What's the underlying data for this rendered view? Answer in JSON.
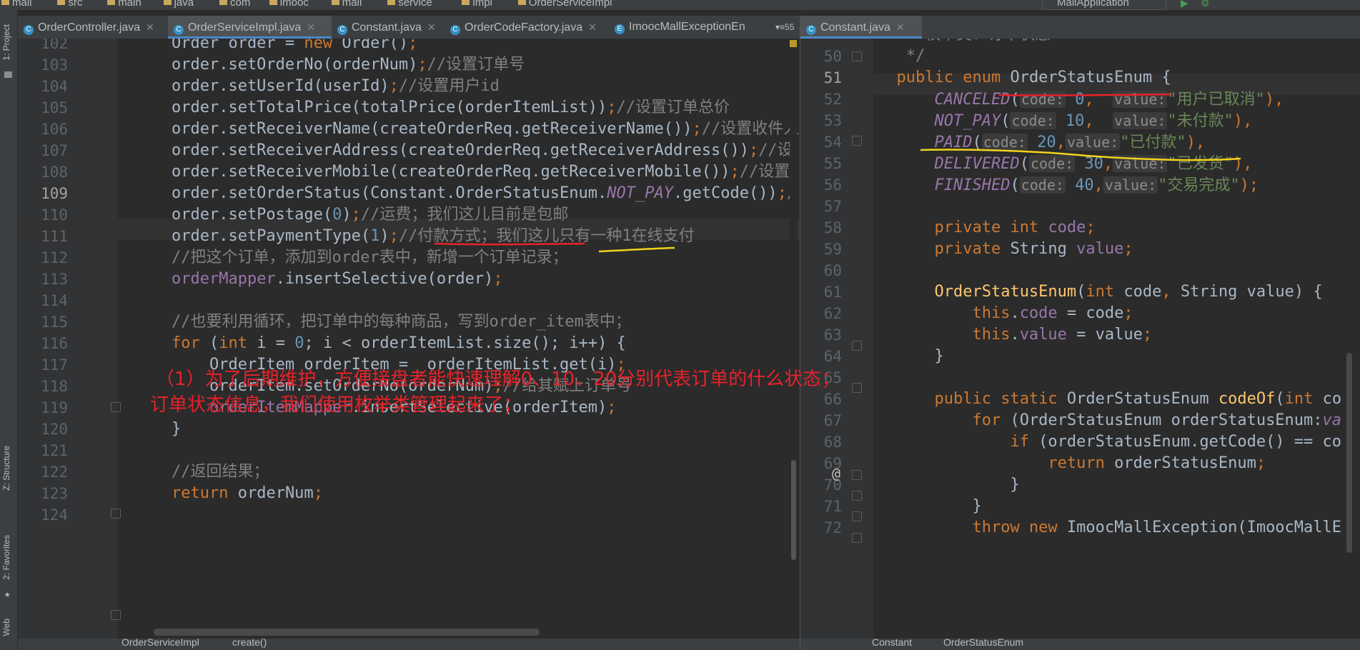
{
  "navbar": {
    "crumbs": [
      "mall",
      "src",
      "main",
      "java",
      "com",
      "imooc",
      "mall",
      "service",
      "impl",
      "OrderServiceImpl"
    ],
    "run_config": "MallApplication"
  },
  "left_strip": {
    "project_label": "1: Project",
    "structure_label": "Z: Structure",
    "favorites_label": "2: Favorites",
    "web_label": "Web"
  },
  "left_tabs": [
    {
      "label": "OrderController.java",
      "active": false
    },
    {
      "label": "OrderServiceImpl.java",
      "active": true
    },
    {
      "label": "Constant.java",
      "active": false
    },
    {
      "label": "OrderCodeFactory.java",
      "active": false
    },
    {
      "label": "ImoocMallExceptionEn",
      "active": false
    }
  ],
  "left_tabs_overflow": "▾≡55",
  "right_tabs": [
    {
      "label": "Constant.java",
      "active": true
    }
  ],
  "left_editor": {
    "lines": [
      {
        "n": "102",
        "segs": [
          [
            "    Order order = ",
            ""
          ],
          [
            "new",
            "kw"
          ],
          [
            " Order()",
            ""
          ],
          [
            ";",
            "kw"
          ]
        ]
      },
      {
        "n": "103",
        "segs": [
          [
            "    order.setOrderNo(orderNum)",
            ""
          ],
          [
            ";",
            "kw"
          ],
          [
            "//设置订单号",
            "cmt"
          ]
        ]
      },
      {
        "n": "104",
        "segs": [
          [
            "    order.setUserId(userId)",
            ""
          ],
          [
            ";",
            "kw"
          ],
          [
            "//设置用户id",
            "cmt"
          ]
        ]
      },
      {
        "n": "105",
        "segs": [
          [
            "    order.setTotalPrice(totalPrice(orderItemList))",
            ""
          ],
          [
            ";",
            "kw"
          ],
          [
            "//设置订单总价",
            "cmt"
          ]
        ]
      },
      {
        "n": "106",
        "segs": [
          [
            "    order.setReceiverName(createOrderReq.getReceiverName())",
            ""
          ],
          [
            ";",
            "kw"
          ],
          [
            "//设置收件人",
            "cmt"
          ]
        ]
      },
      {
        "n": "107",
        "segs": [
          [
            "    order.setReceiverAddress(createOrderReq.getReceiverAddress())",
            ""
          ],
          [
            ";",
            "kw"
          ],
          [
            "//设",
            "cmt"
          ]
        ]
      },
      {
        "n": "108",
        "segs": [
          [
            "    order.setReceiverMobile(createOrderReq.getReceiverMobile())",
            ""
          ],
          [
            ";",
            "kw"
          ],
          [
            "//设置",
            "cmt"
          ]
        ]
      },
      {
        "n": "109",
        "cur": true,
        "segs": [
          [
            "    order.setOrderStatus(Constant.OrderStatusEnum.",
            ""
          ],
          [
            "NOT_PAY",
            "fld ital"
          ],
          [
            ".getCode())",
            ""
          ],
          [
            ";",
            "kw"
          ],
          [
            "/",
            "cmt"
          ]
        ]
      },
      {
        "n": "110",
        "segs": [
          [
            "    order.setPostage(",
            ""
          ],
          [
            "0",
            "num"
          ],
          [
            ")",
            ""
          ],
          [
            ";",
            "kw"
          ],
          [
            "//运费；我们这儿目前是包邮",
            "cmt"
          ]
        ]
      },
      {
        "n": "111",
        "segs": [
          [
            "    order.setPaymentType(",
            ""
          ],
          [
            "1",
            "num"
          ],
          [
            ")",
            ""
          ],
          [
            ";",
            "kw"
          ],
          [
            "//付款方式；我们这儿只有一种1在线支付",
            "cmt"
          ]
        ]
      },
      {
        "n": "112",
        "segs": [
          [
            "    ",
            ""
          ],
          [
            "//把这个订单，添加到order表中，新增一个订单记录；",
            "cmt"
          ]
        ]
      },
      {
        "n": "113",
        "segs": [
          [
            "    ",
            ""
          ],
          [
            "orderMapper",
            "fld"
          ],
          [
            ".insertSelective(order)",
            ""
          ],
          [
            ";",
            "kw"
          ]
        ]
      },
      {
        "n": "114",
        "segs": [
          [
            "",
            ""
          ]
        ]
      },
      {
        "n": "115",
        "segs": [
          [
            "    ",
            ""
          ],
          [
            "//也要利用循环，把订单中的每种商品，写到order_item表中；",
            "cmt"
          ]
        ]
      },
      {
        "n": "116",
        "segs": [
          [
            "    ",
            ""
          ],
          [
            "for",
            "kw"
          ],
          [
            " (",
            ""
          ],
          [
            "int",
            "kw"
          ],
          [
            " i = ",
            ""
          ],
          [
            "0",
            "num"
          ],
          [
            "; i < orderItemList.size(); i++) {",
            ""
          ]
        ]
      },
      {
        "n": "117",
        "segs": [
          [
            "        OrderItem orderItem =  orderItemList.get(i)",
            ""
          ],
          [
            ";",
            "kw"
          ]
        ]
      },
      {
        "n": "118",
        "segs": [
          [
            "        orderItem.setOrderNo(orderNum)",
            ""
          ],
          [
            ";",
            "kw"
          ],
          [
            "//给其赋上订单号",
            "cmt"
          ]
        ]
      },
      {
        "n": "119",
        "segs": [
          [
            "        ",
            ""
          ],
          [
            "orderItemMapper",
            "fld"
          ],
          [
            ".insertSelective(orderItem)",
            ""
          ],
          [
            ";",
            "kw"
          ]
        ]
      },
      {
        "n": "120",
        "segs": [
          [
            "    }",
            ""
          ]
        ]
      },
      {
        "n": "121",
        "segs": [
          [
            "",
            ""
          ]
        ]
      },
      {
        "n": "122",
        "segs": [
          [
            "    ",
            ""
          ],
          [
            "//返回结果；",
            "cmt"
          ]
        ]
      },
      {
        "n": "123",
        "segs": [
          [
            "    ",
            ""
          ],
          [
            "return",
            "kw"
          ],
          [
            " orderNum",
            ""
          ],
          [
            ";",
            "kw"
          ]
        ]
      },
      {
        "n": "124",
        "segs": [
          [
            "",
            ""
          ]
        ]
      }
    ],
    "breadcrumb": [
      "OrderServiceImpl",
      "create()"
    ]
  },
  "right_editor": {
    "lines": [
      {
        "n": "",
        "segs": [
          [
            "   ",
            ""
          ],
          [
            "* 枚举类：订单状态",
            "cmt"
          ]
        ]
      },
      {
        "n": "50",
        "segs": [
          [
            "   ",
            ""
          ],
          [
            "*/",
            "cmt"
          ]
        ]
      },
      {
        "n": "51",
        "cur": true,
        "segs": [
          [
            "  ",
            ""
          ],
          [
            "public enum",
            "kw"
          ],
          [
            " OrderStatusEnum {",
            ""
          ]
        ]
      },
      {
        "n": "52",
        "segs": [
          [
            "      ",
            ""
          ],
          [
            "CANCELED",
            "fld ital"
          ],
          [
            "(",
            ""
          ],
          [
            "code:",
            "hint"
          ],
          [
            " ",
            ""
          ],
          [
            "0",
            "num"
          ],
          [
            ",  ",
            "kw"
          ],
          [
            "value:",
            "hint"
          ],
          [
            "\"用户已取消\"",
            "str"
          ],
          [
            "),",
            "kw"
          ]
        ]
      },
      {
        "n": "53",
        "segs": [
          [
            "      ",
            ""
          ],
          [
            "NOT_PAY",
            "fld ital"
          ],
          [
            "(",
            ""
          ],
          [
            "code:",
            "hint"
          ],
          [
            " ",
            ""
          ],
          [
            "10",
            "num"
          ],
          [
            ",  ",
            "kw"
          ],
          [
            "value:",
            "hint"
          ],
          [
            "\"未付款\"",
            "str"
          ],
          [
            "),",
            "kw"
          ]
        ]
      },
      {
        "n": "54",
        "segs": [
          [
            "      ",
            ""
          ],
          [
            "PAID",
            "fld ital"
          ],
          [
            "(",
            ""
          ],
          [
            "code:",
            "hint"
          ],
          [
            " ",
            ""
          ],
          [
            "20",
            "num"
          ],
          [
            ",",
            "kw"
          ],
          [
            "value:",
            "hint"
          ],
          [
            "\"已付款\"",
            "str"
          ],
          [
            "),",
            "kw"
          ]
        ]
      },
      {
        "n": "55",
        "segs": [
          [
            "      ",
            ""
          ],
          [
            "DELIVERED",
            "fld ital"
          ],
          [
            "(",
            ""
          ],
          [
            "code:",
            "hint"
          ],
          [
            " ",
            ""
          ],
          [
            "30",
            "num"
          ],
          [
            ",",
            "kw"
          ],
          [
            "value:",
            "hint"
          ],
          [
            "\"已发货\"",
            "str"
          ],
          [
            "),",
            "kw"
          ]
        ]
      },
      {
        "n": "56",
        "segs": [
          [
            "      ",
            ""
          ],
          [
            "FINISHED",
            "fld ital"
          ],
          [
            "(",
            ""
          ],
          [
            "code:",
            "hint"
          ],
          [
            " ",
            ""
          ],
          [
            "40",
            "num"
          ],
          [
            ",",
            "kw"
          ],
          [
            "value:",
            "hint"
          ],
          [
            "\"交易完成\"",
            "str"
          ],
          [
            ");",
            "kw"
          ]
        ]
      },
      {
        "n": "57",
        "segs": [
          [
            "",
            ""
          ]
        ]
      },
      {
        "n": "58",
        "segs": [
          [
            "      ",
            ""
          ],
          [
            "private int",
            "kw"
          ],
          [
            " ",
            ""
          ],
          [
            "code",
            "fld"
          ],
          [
            ";",
            "kw"
          ]
        ]
      },
      {
        "n": "59",
        "segs": [
          [
            "      ",
            ""
          ],
          [
            "private",
            "kw"
          ],
          [
            " String ",
            ""
          ],
          [
            "value",
            "fld"
          ],
          [
            ";",
            "kw"
          ]
        ]
      },
      {
        "n": "60",
        "segs": [
          [
            "",
            ""
          ]
        ]
      },
      {
        "n": "61",
        "segs": [
          [
            "      ",
            ""
          ],
          [
            "OrderStatusEnum",
            "fn"
          ],
          [
            "(",
            ""
          ],
          [
            "int",
            "kw"
          ],
          [
            " code",
            ""
          ],
          [
            ",",
            "kw"
          ],
          [
            " String value) {",
            ""
          ]
        ]
      },
      {
        "n": "62",
        "segs": [
          [
            "          ",
            ""
          ],
          [
            "this",
            "kw"
          ],
          [
            ".",
            ""
          ],
          [
            "code",
            "fld"
          ],
          [
            " = code",
            ""
          ],
          [
            ";",
            "kw"
          ]
        ]
      },
      {
        "n": "63",
        "segs": [
          [
            "          ",
            ""
          ],
          [
            "this",
            "kw"
          ],
          [
            ".",
            ""
          ],
          [
            "value",
            "fld"
          ],
          [
            " = value",
            ""
          ],
          [
            ";",
            "kw"
          ]
        ]
      },
      {
        "n": "64",
        "segs": [
          [
            "      }",
            ""
          ]
        ]
      },
      {
        "n": "65",
        "segs": [
          [
            "",
            ""
          ]
        ]
      },
      {
        "n": "66",
        "segs": [
          [
            "      ",
            ""
          ],
          [
            "public static",
            "kw"
          ],
          [
            " OrderStatusEnum ",
            ""
          ],
          [
            "codeOf",
            "fn"
          ],
          [
            "(",
            ""
          ],
          [
            "int",
            "kw"
          ],
          [
            " co",
            ""
          ]
        ]
      },
      {
        "n": "67",
        "segs": [
          [
            "          ",
            ""
          ],
          [
            "for",
            "kw"
          ],
          [
            " (OrderStatusEnum orderStatusEnum:",
            ""
          ],
          [
            "va",
            "fld ital"
          ]
        ]
      },
      {
        "n": "68",
        "segs": [
          [
            "              ",
            ""
          ],
          [
            "if",
            "kw"
          ],
          [
            " (orderStatusEnum.getCode() == co",
            ""
          ]
        ]
      },
      {
        "n": "69",
        "segs": [
          [
            "                  ",
            ""
          ],
          [
            "return",
            "kw"
          ],
          [
            " orderStatusEnum",
            ""
          ],
          [
            ";",
            "kw"
          ]
        ]
      },
      {
        "n": "70",
        "segs": [
          [
            "              }",
            ""
          ]
        ]
      },
      {
        "n": "71",
        "segs": [
          [
            "          }",
            ""
          ]
        ]
      },
      {
        "n": "72",
        "segs": [
          [
            "          ",
            ""
          ],
          [
            "throw new",
            "kw"
          ],
          [
            " ImoocMallException(ImoocMallE",
            ""
          ]
        ]
      }
    ],
    "breadcrumb": [
      "Constant",
      "OrderStatusEnum"
    ]
  },
  "annotation": {
    "line1": "（1）为了后期维护，方便接盘者能快速理解0、10、20分别代表订单的什么状态；",
    "line2": "订单状态信息，我们使用枚举类管理起来了；",
    "color": "#e8222a"
  }
}
